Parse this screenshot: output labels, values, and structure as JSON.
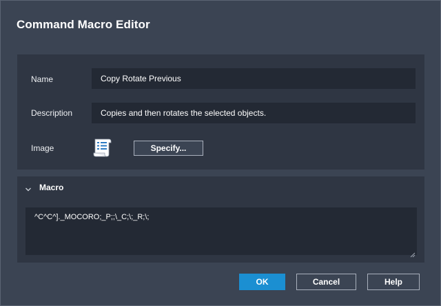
{
  "dialog": {
    "title": "Command Macro Editor"
  },
  "properties": {
    "name_label": "Name",
    "name_value": "Copy Rotate Previous",
    "description_label": "Description",
    "description_value": "Copies and then rotates the selected objects.",
    "image_label": "Image",
    "image_icon": "scroll-list-icon",
    "specify_label": "Specify..."
  },
  "macro": {
    "section_label": "Macro",
    "expanded": true,
    "value": "^C^C^]._MOCORO;_P;;\\_C;\\;_R;\\;"
  },
  "footer": {
    "ok_label": "OK",
    "cancel_label": "Cancel",
    "help_label": "Help"
  },
  "colors": {
    "background": "#3b4453",
    "panel": "#2f3643",
    "field": "#232934",
    "accent": "#1b8fd2",
    "border": "#aab1bd"
  }
}
